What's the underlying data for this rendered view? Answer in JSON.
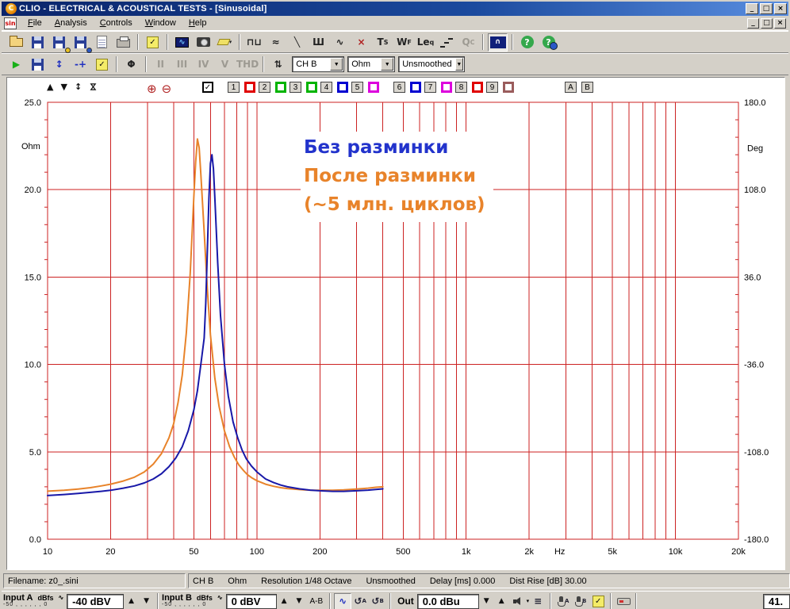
{
  "window": {
    "title": "CLIO - ELECTRICAL & ACOUSTICAL TESTS - [Sinusoidal]",
    "controls": [
      {
        "name": "minimize-button",
        "glyph": "_"
      },
      {
        "name": "maximize-button",
        "glyph": "□"
      },
      {
        "name": "close-button",
        "glyph": "×"
      }
    ]
  },
  "menu": {
    "doc_icon": "sin",
    "items": [
      "File",
      "Analysis",
      "Controls",
      "Window",
      "Help"
    ],
    "child_controls": [
      {
        "name": "child-minimize-button",
        "glyph": "_"
      },
      {
        "name": "child-restore-button",
        "glyph": "□"
      },
      {
        "name": "child-close-button",
        "glyph": "×"
      }
    ]
  },
  "toolbar_main": {
    "icons": [
      {
        "name": "open-icon",
        "type": "folder"
      },
      {
        "name": "save-icon",
        "type": "floppy"
      },
      {
        "name": "save-as-icon",
        "type": "floppy",
        "dot": "#e8c020"
      },
      {
        "name": "export-icon",
        "type": "floppy",
        "dot": "#2a58c8"
      },
      {
        "name": "page-setup-icon",
        "type": "page"
      },
      {
        "name": "print-icon",
        "type": "printer"
      },
      {
        "sep": true
      },
      {
        "name": "options-icon",
        "type": "checklist",
        "glyph": "✓"
      },
      {
        "sep": true
      },
      {
        "name": "movie-icon",
        "type": "film",
        "glyph": "∿"
      },
      {
        "name": "snapshot-icon",
        "type": "camera"
      },
      {
        "name": "erase-icon",
        "type": "eraser",
        "dropdown": "▾"
      },
      {
        "sep": true
      },
      {
        "name": "mls-analysis-icon",
        "glyph": "⊓⊔"
      },
      {
        "name": "noise-analysis-icon",
        "glyph": "≈"
      },
      {
        "name": "decay-analysis-icon",
        "glyph": "╲"
      },
      {
        "name": "rta-analysis-icon",
        "glyph": "Ш"
      },
      {
        "name": "sinusoidal-analysis-icon",
        "glyph": "∿"
      },
      {
        "name": "stop-analysis-icon",
        "glyph": "×",
        "color": "#b02020"
      },
      {
        "name": "thiele-small-icon",
        "glyph": "T",
        "cap": "S"
      },
      {
        "name": "waterfall-icon",
        "glyph": "W",
        "cap": "F"
      },
      {
        "name": "leq-analysis-icon",
        "glyph": "Le",
        "cap": "q"
      },
      {
        "name": "steps-icon",
        "type": "stairs"
      },
      {
        "name": "qc-icon",
        "glyph": "Q",
        "cap": "C",
        "disabled": true
      },
      {
        "sep": true
      },
      {
        "name": "active-window-icon",
        "type": "window",
        "glyph": "∩",
        "pressed": true
      },
      {
        "sep": true
      },
      {
        "name": "help-icon",
        "type": "help",
        "glyph": "?"
      },
      {
        "name": "context-help-icon",
        "type": "help-key",
        "glyph": "?"
      }
    ]
  },
  "toolbar_measure": {
    "icons": [
      {
        "name": "run-button",
        "glyph": "▶",
        "color": "#18b018"
      },
      {
        "name": "save-measure-icon",
        "type": "floppy"
      },
      {
        "name": "autoscale-icon",
        "glyph": "↕",
        "color": "#2030c0"
      },
      {
        "name": "calibration-icon",
        "glyph": "-+",
        "color": "#2030c0"
      },
      {
        "name": "settings-icon",
        "type": "checklist",
        "glyph": "✓"
      },
      {
        "sep": true
      },
      {
        "name": "phase-icon",
        "glyph": "Φ"
      },
      {
        "sep": true
      },
      {
        "name": "harmonic-2-icon",
        "glyph": "II",
        "disabled": true
      },
      {
        "name": "harmonic-3-icon",
        "glyph": "III",
        "disabled": true
      },
      {
        "name": "harmonic-4-icon",
        "glyph": "IV",
        "disabled": true
      },
      {
        "name": "harmonic-5-icon",
        "glyph": "V",
        "disabled": true
      },
      {
        "name": "thd-icon",
        "glyph": "THD",
        "disabled": true
      },
      {
        "sep": true
      },
      {
        "name": "scale-adjust-icon",
        "glyph": "⇅"
      }
    ],
    "channel_select": "CH B",
    "unit_select": "Ohm",
    "smoothing_select": "Unsmoothed"
  },
  "graph_toolbar": {
    "nav": [
      {
        "name": "shift-up-icon",
        "glyph": "▲"
      },
      {
        "name": "shift-down-icon",
        "glyph": "▼"
      },
      {
        "name": "expand-scale-icon",
        "glyph": "↕"
      },
      {
        "name": "compress-scale-icon",
        "glyph": "⋈",
        "rot": true
      }
    ],
    "zoom": [
      {
        "name": "zoom-in-icon",
        "glyph": "⊕"
      },
      {
        "name": "zoom-out-icon",
        "glyph": "⊖"
      }
    ],
    "marker_checkbox": {
      "checked": true,
      "glyph": "✓"
    },
    "curve_slots": [
      {
        "label": "1",
        "color": "#e00000"
      },
      {
        "label": "2",
        "color": "#00b400"
      },
      {
        "label": "3",
        "color": "#00b400"
      },
      {
        "label": "4",
        "color": "#0000d0"
      },
      {
        "label": "5",
        "color": "#dd00dd"
      },
      {
        "label": "6",
        "color": "#0000d0"
      },
      {
        "label": "7",
        "color": "#dd00dd"
      },
      {
        "label": "8",
        "color": "#e00000"
      },
      {
        "label": "9",
        "color": "#9a5c5c"
      }
    ],
    "ab_buttons": [
      "A",
      "B"
    ]
  },
  "chart_data": {
    "type": "line",
    "x_scale": "log",
    "xlim": [
      10,
      20000
    ],
    "ylim_left": [
      0,
      25
    ],
    "ylim_right": [
      -180,
      180
    ],
    "ylabel_left": "Ohm",
    "ylabel_right": "Deg",
    "x_unit": "Hz",
    "grid_color": "#cc2222",
    "x_ticks": [
      {
        "v": 10,
        "label": "10"
      },
      {
        "v": 20,
        "label": "20"
      },
      {
        "v": 50,
        "label": "50"
      },
      {
        "v": 100,
        "label": "100"
      },
      {
        "v": 200,
        "label": "200"
      },
      {
        "v": 500,
        "label": "500"
      },
      {
        "v": 1000,
        "label": "1k"
      },
      {
        "v": 2000,
        "label": "2k"
      },
      {
        "v": 2800,
        "label": "Hz"
      },
      {
        "v": 5000,
        "label": "5k"
      },
      {
        "v": 10000,
        "label": "10k"
      },
      {
        "v": 20000,
        "label": "20k"
      }
    ],
    "y_ticks_left": [
      {
        "v": 25,
        "label": "25.0"
      },
      {
        "v": 20,
        "label": "20.0"
      },
      {
        "v": 15,
        "label": "15.0"
      },
      {
        "v": 10,
        "label": "10.0"
      },
      {
        "v": 5,
        "label": "5.0"
      },
      {
        "v": 0,
        "label": "0.0"
      }
    ],
    "y_ticks_right": [
      {
        "v": 180,
        "label": "180.0"
      },
      {
        "v": 108,
        "label": "108.0"
      },
      {
        "v": 36,
        "label": "36.0"
      },
      {
        "v": -36,
        "label": "-36.0"
      },
      {
        "v": -108,
        "label": "-108.0"
      },
      {
        "v": -180,
        "label": "-180.0"
      }
    ],
    "legend": [
      {
        "text": "Без разминки",
        "color": "#2233cc"
      },
      {
        "text": "После разминки",
        "color": "#e8832a"
      },
      {
        "text": "(~5 млн. циклов)",
        "color": "#e8832a"
      }
    ],
    "series": [
      {
        "name": "Без разминки",
        "color": "#1818a8",
        "points": [
          [
            10,
            2.5
          ],
          [
            12,
            2.56
          ],
          [
            14,
            2.62
          ],
          [
            16,
            2.68
          ],
          [
            18,
            2.74
          ],
          [
            20,
            2.8
          ],
          [
            23,
            2.92
          ],
          [
            26,
            3.05
          ],
          [
            29,
            3.22
          ],
          [
            32,
            3.45
          ],
          [
            35,
            3.75
          ],
          [
            38,
            4.15
          ],
          [
            41,
            4.65
          ],
          [
            44,
            5.3
          ],
          [
            47,
            6.2
          ],
          [
            50,
            7.4
          ],
          [
            52,
            8.5
          ],
          [
            54,
            10.0
          ],
          [
            56,
            11.5
          ],
          [
            57,
            13.5
          ],
          [
            58,
            16.5
          ],
          [
            59,
            19.5
          ],
          [
            60,
            21.5
          ],
          [
            61,
            22.0
          ],
          [
            62,
            21.2
          ],
          [
            63,
            19.5
          ],
          [
            65,
            15.8
          ],
          [
            67,
            12.8
          ],
          [
            70,
            10.0
          ],
          [
            73,
            8.2
          ],
          [
            77,
            6.7
          ],
          [
            81,
            5.8
          ],
          [
            85,
            5.1
          ],
          [
            89,
            4.6
          ],
          [
            94,
            4.2
          ],
          [
            100,
            3.85
          ],
          [
            110,
            3.45
          ],
          [
            120,
            3.25
          ],
          [
            130,
            3.1
          ],
          [
            140,
            3.0
          ],
          [
            160,
            2.88
          ],
          [
            180,
            2.81
          ],
          [
            200,
            2.77
          ],
          [
            230,
            2.74
          ],
          [
            260,
            2.74
          ],
          [
            300,
            2.77
          ],
          [
            340,
            2.81
          ],
          [
            370,
            2.85
          ],
          [
            400,
            2.88
          ]
        ]
      },
      {
        "name": "После разминки (~5 млн. циклов)",
        "color": "#e8832a",
        "points": [
          [
            10,
            2.75
          ],
          [
            12,
            2.8
          ],
          [
            14,
            2.87
          ],
          [
            16,
            2.95
          ],
          [
            18,
            3.05
          ],
          [
            20,
            3.15
          ],
          [
            23,
            3.33
          ],
          [
            26,
            3.55
          ],
          [
            29,
            3.85
          ],
          [
            32,
            4.3
          ],
          [
            35,
            4.9
          ],
          [
            38,
            5.8
          ],
          [
            40,
            6.6
          ],
          [
            42,
            7.8
          ],
          [
            44,
            9.4
          ],
          [
            46,
            11.8
          ],
          [
            48,
            15.2
          ],
          [
            50,
            19.6
          ],
          [
            51,
            21.6
          ],
          [
            52,
            22.9
          ],
          [
            53,
            22.4
          ],
          [
            54,
            20.9
          ],
          [
            56,
            17.6
          ],
          [
            58,
            14.3
          ],
          [
            60,
            11.7
          ],
          [
            63,
            9.2
          ],
          [
            66,
            7.6
          ],
          [
            70,
            6.2
          ],
          [
            74,
            5.3
          ],
          [
            78,
            4.7
          ],
          [
            82,
            4.25
          ],
          [
            86,
            3.95
          ],
          [
            90,
            3.7
          ],
          [
            95,
            3.5
          ],
          [
            100,
            3.35
          ],
          [
            110,
            3.15
          ],
          [
            120,
            3.03
          ],
          [
            130,
            2.95
          ],
          [
            140,
            2.9
          ],
          [
            160,
            2.84
          ],
          [
            180,
            2.81
          ],
          [
            200,
            2.8
          ],
          [
            230,
            2.8
          ],
          [
            260,
            2.82
          ],
          [
            300,
            2.87
          ],
          [
            340,
            2.92
          ],
          [
            370,
            2.97
          ],
          [
            400,
            3.0
          ]
        ]
      }
    ]
  },
  "status_bar": {
    "filename": "Filename: z0_.sini",
    "items": [
      "CH B",
      "Ohm",
      "Resolution 1/48 Octave",
      "Unsmoothed",
      "Delay [ms] 0.000",
      "Dist Rise [dB] 30.00"
    ]
  },
  "bottom_bar": {
    "input_a": {
      "label": "Input A",
      "unit": "dBfs",
      "scale": "-50 , , , , , , 0",
      "value": "-40 dBV"
    },
    "input_b": {
      "label": "Input B",
      "unit": "dBfs",
      "scale": "-50 , , , , , , 0",
      "value": "0 dBV"
    },
    "ab_label": "A-B",
    "out_label": "Out",
    "out_value": "0.0 dBu",
    "right_value": "41."
  }
}
